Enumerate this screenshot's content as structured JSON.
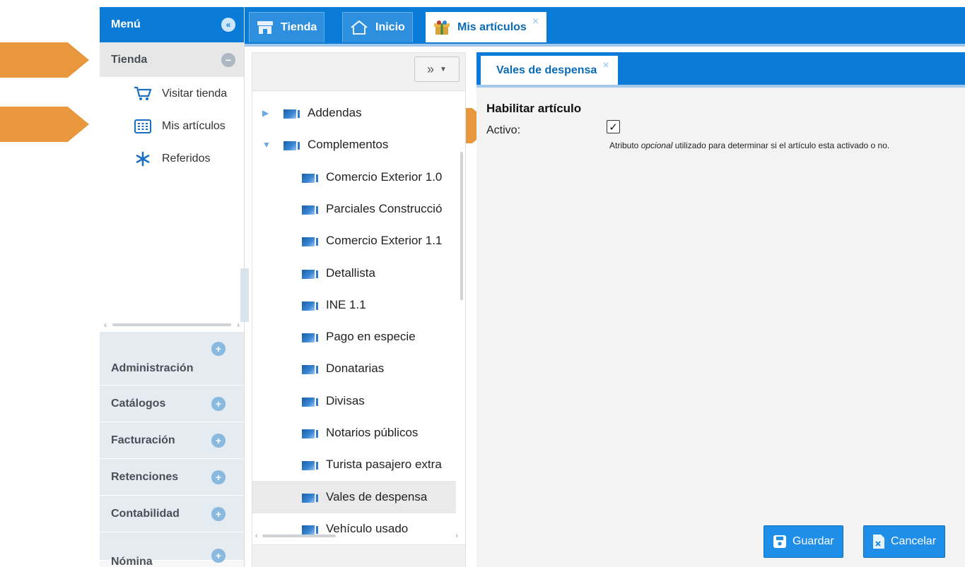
{
  "menu": {
    "title": "Menú",
    "collapse_icon": "double-chevron-left-icon",
    "open_section": "Tienda",
    "open_section_icon": "minus-circle-icon",
    "items": [
      {
        "label": "Visitar tienda",
        "icon": "cart-icon"
      },
      {
        "label": "Mis artículos",
        "icon": "grid-icon"
      },
      {
        "label": "Referidos",
        "icon": "asterisk-icon"
      }
    ],
    "sections": [
      "Administración",
      "Catálogos",
      "Facturación",
      "Retenciones",
      "Contabilidad",
      "Nómina"
    ],
    "section_icon": "plus-circle-icon"
  },
  "tabs": [
    {
      "label": "Tienda",
      "icon": "store-icon"
    },
    {
      "label": "Inicio",
      "icon": "home-icon"
    },
    {
      "label": "Mis artículos",
      "icon": "gift-icon",
      "active": true,
      "close": "×"
    }
  ],
  "tree": {
    "toolbar_button": "»",
    "nodes": [
      {
        "label": "Addendas",
        "level": 0,
        "expanded": false
      },
      {
        "label": "Complementos",
        "level": 0,
        "expanded": true
      },
      {
        "label": "Comercio Exterior 1.0",
        "level": 1
      },
      {
        "label": "Parciales Construcció",
        "level": 1
      },
      {
        "label": "Comercio Exterior 1.1",
        "level": 1
      },
      {
        "label": "Detallista",
        "level": 1
      },
      {
        "label": "INE 1.1",
        "level": 1
      },
      {
        "label": "Pago en especie",
        "level": 1
      },
      {
        "label": "Donatarias",
        "level": 1
      },
      {
        "label": "Divisas",
        "level": 1
      },
      {
        "label": "Notarios públicos",
        "level": 1
      },
      {
        "label": "Turista pasajero extra",
        "level": 1
      },
      {
        "label": "Vales de despensa",
        "level": 1,
        "selected": true
      },
      {
        "label": "Vehículo usado",
        "level": 1
      }
    ]
  },
  "detail": {
    "tab_label": "Vales de despensa",
    "tab_close": "×",
    "section_title": "Habilitar artículo",
    "field_label": "Activo:",
    "checked": true,
    "hint_prefix": "Atributo ",
    "hint_em": "opcional",
    "hint_suffix": " utilizado para determinar si el artículo esta activado o no.",
    "save_label": "Guardar",
    "cancel_label": "Cancelar"
  },
  "colors": {
    "accent": "#0a7bd6",
    "arrow": "#e8973c",
    "button": "#1f8ee8"
  }
}
